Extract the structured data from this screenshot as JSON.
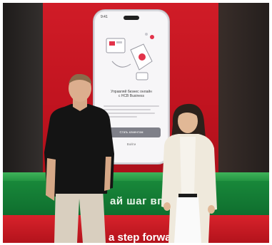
{
  "scene": {
    "phone_screen": {
      "status_time": "9:41",
      "title_lines": [
        "Управляй бизнес онлайн",
        "с HCB Business"
      ],
      "primary_button": "Стать клиентом",
      "secondary_link": "Войти"
    },
    "stage_text_green": "ай шаг впер",
    "stage_text_red": "a step forwa"
  },
  "colors": {
    "red_panel": "#c0131f",
    "green_stage": "#18883a",
    "red_stage": "#d8222b"
  }
}
